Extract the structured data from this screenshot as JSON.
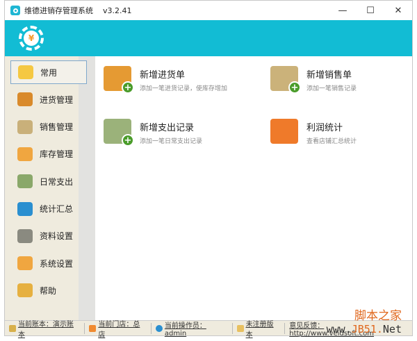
{
  "window": {
    "title": "维德进销存管理系统",
    "version": "v3.2.41",
    "minimize": "—",
    "maximize": "☐",
    "close": "✕"
  },
  "banner": {
    "logo_symbol": "¥"
  },
  "sidebar": {
    "items": [
      {
        "label": "常用",
        "icon": "lightbulb-icon",
        "color": "#f5c842"
      },
      {
        "label": "进货管理",
        "icon": "truck-icon",
        "color": "#d98a2b"
      },
      {
        "label": "销售管理",
        "icon": "cart-icon",
        "color": "#c9b07a"
      },
      {
        "label": "库存管理",
        "icon": "box-icon",
        "color": "#f0a640"
      },
      {
        "label": "日常支出",
        "icon": "binders-icon",
        "color": "#8aa86a"
      },
      {
        "label": "统计汇总",
        "icon": "chart-dome-icon",
        "color": "#2a8fd0"
      },
      {
        "label": "资料设置",
        "icon": "document-icon",
        "color": "#8a8a80"
      },
      {
        "label": "系统设置",
        "icon": "gear-icon",
        "color": "#f0a640"
      },
      {
        "label": "帮助",
        "icon": "info-icon",
        "color": "#e6b040"
      }
    ]
  },
  "main": {
    "cards": [
      {
        "title": "新增进货单",
        "desc": "添加一笔进货记录，使库存增加",
        "icon": "truck-add-icon",
        "color": "#e59a33"
      },
      {
        "title": "新增销售单",
        "desc": "添加一笔销售记录",
        "icon": "cart-add-icon",
        "color": "#cbb27a"
      },
      {
        "title": "新增支出记录",
        "desc": "添加一笔日常支出记录",
        "icon": "binders-add-icon",
        "color": "#9bb27a"
      },
      {
        "title": "利润统计",
        "desc": "查看店铺汇总统计",
        "icon": "money-bag-icon",
        "color": "#ef7a2a"
      }
    ]
  },
  "status": {
    "account": "当前账本：演示账本",
    "store": "当前门店：总店",
    "operator": "当前操作员：admin",
    "edition": "未注册版本",
    "feedback": "意见反馈：http://www.veidsoft.com"
  },
  "watermark": {
    "line1": "脚本之家",
    "line2_a": "www.",
    "line2_b": "JB51.",
    "line2_c": "Net"
  }
}
